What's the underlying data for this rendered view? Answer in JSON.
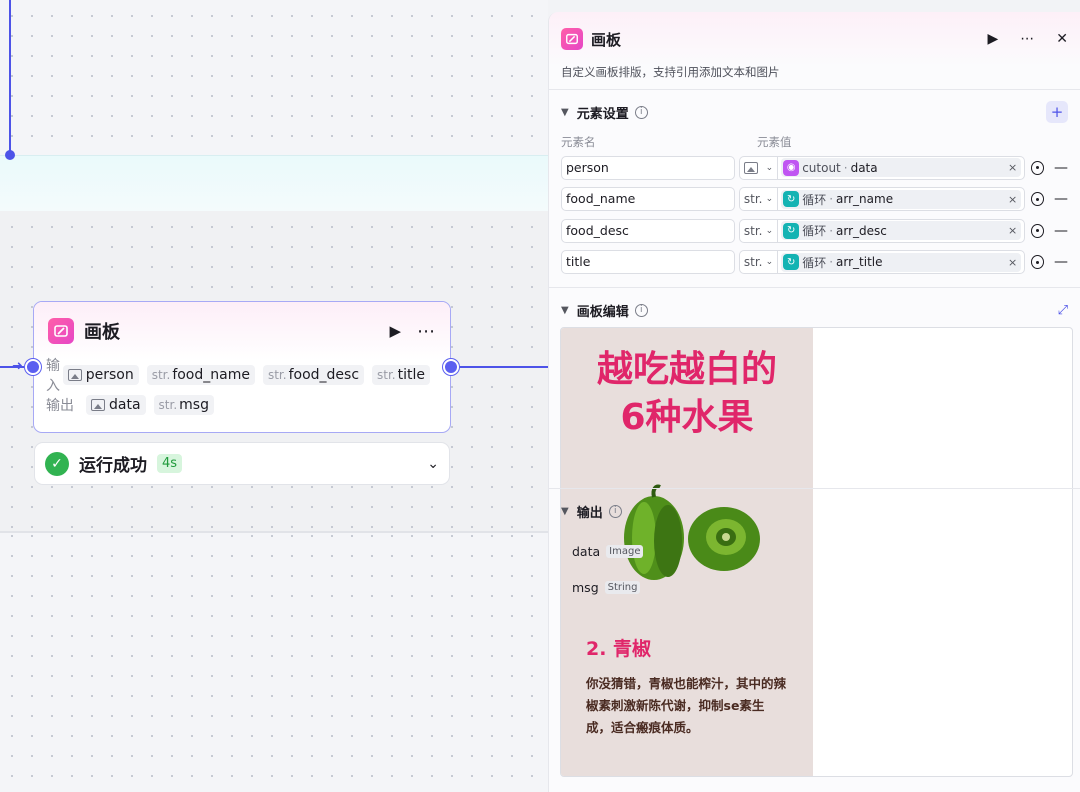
{
  "canvas": {
    "node": {
      "title": "画板",
      "play_icon": "play-icon",
      "more_icon": "more-icon",
      "input_label": "输入",
      "output_label": "输出",
      "inputs": [
        {
          "prefix": "",
          "icon": "image-icon",
          "name": "person"
        },
        {
          "prefix": "str.",
          "icon": "",
          "name": "food_name"
        },
        {
          "prefix": "str.",
          "icon": "",
          "name": "food_desc"
        },
        {
          "prefix": "str.",
          "icon": "",
          "name": "title"
        }
      ],
      "outputs": [
        {
          "prefix": "",
          "icon": "image-icon",
          "name": "data"
        },
        {
          "prefix": "str.",
          "icon": "",
          "name": "msg"
        }
      ]
    },
    "run_status": {
      "text": "运行成功",
      "time": "4s"
    }
  },
  "panel": {
    "title": "画板",
    "description": "自定义画板排版，支持引用添加文本和图片",
    "element_settings": {
      "title": "元素设置",
      "col_name": "元素名",
      "col_value": "元素值",
      "rows": [
        {
          "name": "person",
          "type": "image-icon",
          "type_text": "",
          "source": "cutout",
          "source_icon": "cube-icon",
          "var": "data"
        },
        {
          "name": "food_name",
          "type": "",
          "type_text": "str.",
          "source": "循环",
          "source_icon": "loop-icon",
          "var": "arr_name"
        },
        {
          "name": "food_desc",
          "type": "",
          "type_text": "str.",
          "source": "循环",
          "source_icon": "loop-icon",
          "var": "arr_desc"
        },
        {
          "name": "title",
          "type": "",
          "type_text": "str.",
          "source": "循环",
          "source_icon": "loop-icon",
          "var": "arr_title"
        }
      ]
    },
    "board_edit": {
      "title": "画板编辑",
      "poster": {
        "title_line1": "越吃越白的",
        "title_line2": "6种水果",
        "heading": "2. 青椒",
        "body": "你没猜错，青椒也能榨汁，其中的辣椒素刺激新陈代谢，抑制se素生成，适合瘢痕体质。"
      }
    },
    "output": {
      "title": "输出",
      "items": [
        {
          "name": "data",
          "type": "Image"
        },
        {
          "name": "msg",
          "type": "String"
        }
      ]
    }
  },
  "colors": {
    "accent": "#4d53e8",
    "poster_title": "#e0266a",
    "success": "#31b351",
    "loop_icon": "#14b3b3",
    "cutout_icon": "#c055f2"
  }
}
